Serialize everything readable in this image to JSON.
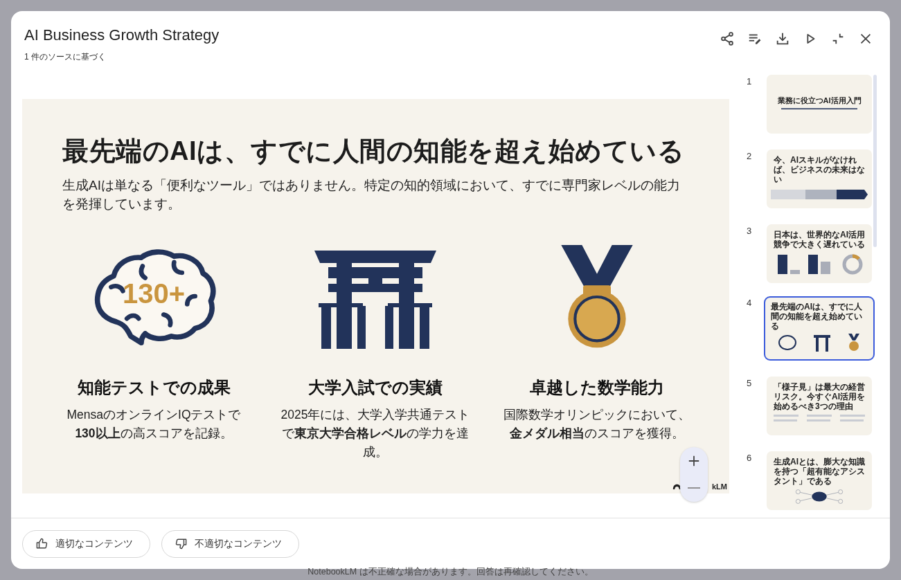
{
  "window": {
    "title": "AI Business Growth Strategy",
    "subtitle": "1 件のソースに基づく"
  },
  "slide": {
    "title": "最先端のAIは、すでに人間の知能を超え始めている",
    "subtitle": "生成AIは単なる「便利なツール」ではありません。特定の知的領域において、すでに専門家レベルの能力を発揮しています。",
    "features": [
      {
        "kind": "brain",
        "badge": "130+",
        "heading": "知能テストでの成果",
        "text": "MensaのオンラインIQテストで **130以上**の高スコアを記録。"
      },
      {
        "kind": "torii",
        "heading": "大学入試での実績",
        "text": "2025年には、大学入学共通テストで**東京大学合格レベル**の学力を達成。"
      },
      {
        "kind": "medal",
        "heading": "卓越した数学能力",
        "text": "国際数学オリンピックにおいて、**金メダル相当**のスコアを獲得。"
      }
    ],
    "logo_text": "kLM"
  },
  "thumbnails": [
    {
      "number": "1",
      "kind": "title",
      "title": "業務に役立つAI活用入門",
      "selected": false
    },
    {
      "number": "2",
      "kind": "steps",
      "title": "今、AIスキルがなければ、ビジネスの未来はない",
      "selected": false
    },
    {
      "number": "3",
      "kind": "chart",
      "title": "日本は、世界的なAI活用競争で大きく遅れている",
      "selected": false
    },
    {
      "number": "4",
      "kind": "icons",
      "title": "最先端のAIは、すでに人間の知能を超え始めている",
      "selected": true
    },
    {
      "number": "5",
      "kind": "numbered",
      "title": "「様子見」は最大の経営リスク。今すぐAI活用を始めるべき3つの理由",
      "selected": false
    },
    {
      "number": "6",
      "kind": "diagram",
      "title": "生成AIとは、膨大な知識を持つ「超有能なアシスタント」である",
      "selected": false
    }
  ],
  "feedback": [
    {
      "kind": "like",
      "label": "適切なコンテンツ"
    },
    {
      "kind": "dislike",
      "label": "不適切なコンテンツ"
    }
  ],
  "disclaimer": "NotebookLM は不正確な場合があります。回答は再確認してください。"
}
